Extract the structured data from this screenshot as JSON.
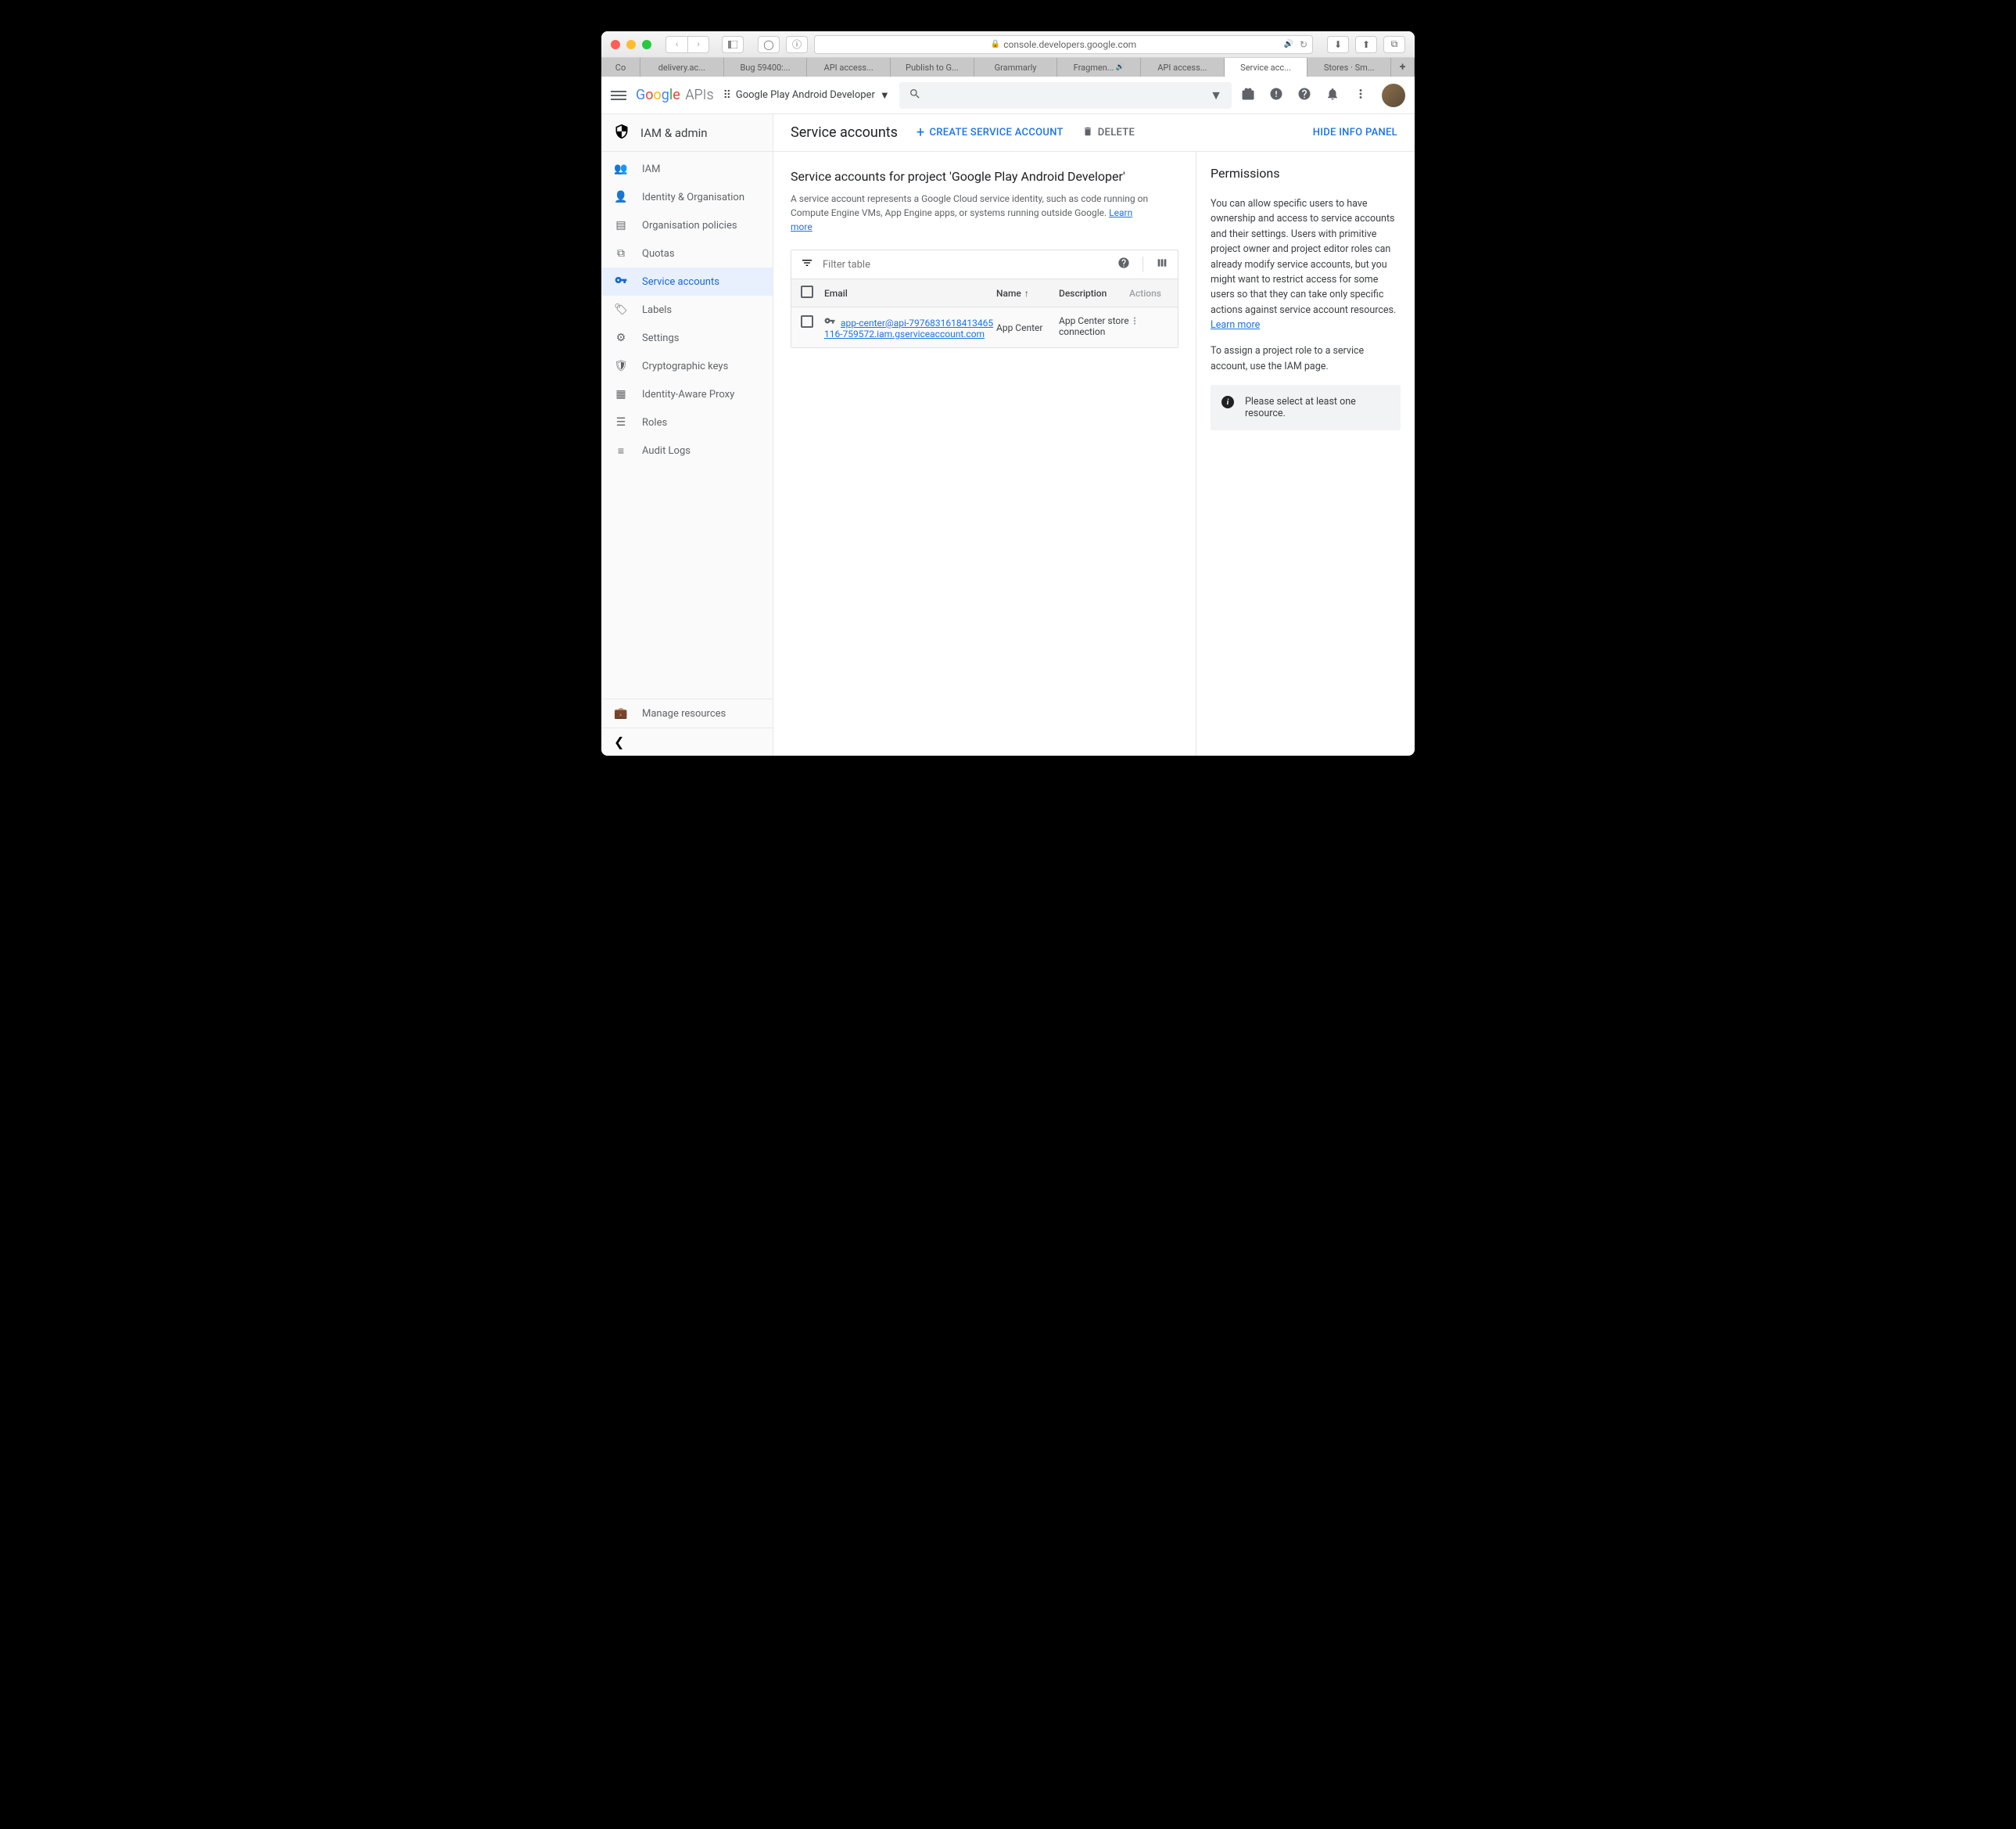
{
  "browser": {
    "url": "console.developers.google.com",
    "tabs": [
      "Co",
      "delivery.ac...",
      "Bug 59400:...",
      "API access...",
      "Publish to G...",
      "Grammarly",
      "Fragmen...",
      "API access...",
      "Service acc...",
      "Stores · Sm..."
    ]
  },
  "appbar": {
    "logo_apis": "APIs",
    "project": "Google Play Android Developer"
  },
  "sidebar": {
    "title": "IAM & admin",
    "items": [
      {
        "label": "IAM"
      },
      {
        "label": "Identity & Organisation"
      },
      {
        "label": "Organisation policies"
      },
      {
        "label": "Quotas"
      },
      {
        "label": "Service accounts"
      },
      {
        "label": "Labels"
      },
      {
        "label": "Settings"
      },
      {
        "label": "Cryptographic keys"
      },
      {
        "label": "Identity-Aware Proxy"
      },
      {
        "label": "Roles"
      },
      {
        "label": "Audit Logs"
      }
    ],
    "footer": "Manage resources"
  },
  "page": {
    "title": "Service accounts",
    "create_btn": "CREATE SERVICE ACCOUNT",
    "delete_btn": "DELETE",
    "hide_panel": "HIDE INFO PANEL",
    "subtitle": "Service accounts for project 'Google Play Android Developer'",
    "description": "A service account represents a Google Cloud service identity, such as code running on Compute Engine VMs, App Engine apps, or systems running outside Google. ",
    "learn_more": "Learn more"
  },
  "table": {
    "filter_placeholder": "Filter table",
    "headers": {
      "email": "Email",
      "name": "Name",
      "description": "Description",
      "actions": "Actions"
    },
    "row": {
      "email": "app-center@api-7976831618413465116-759572.iam.gserviceaccount.com",
      "name": "App Center",
      "description": "App Center store connection"
    }
  },
  "panel": {
    "title": "Permissions",
    "p1": "You can allow specific users to have ownership and access to service accounts and their settings. Users with primitive project owner and project editor roles can already modify service accounts, but you might want to restrict access for some users so that they can take only specific actions against service account resources. ",
    "p1_link": "Learn more",
    "p2": "To assign a project role to a service account, use the IAM page.",
    "alert": "Please select at least one resource."
  }
}
